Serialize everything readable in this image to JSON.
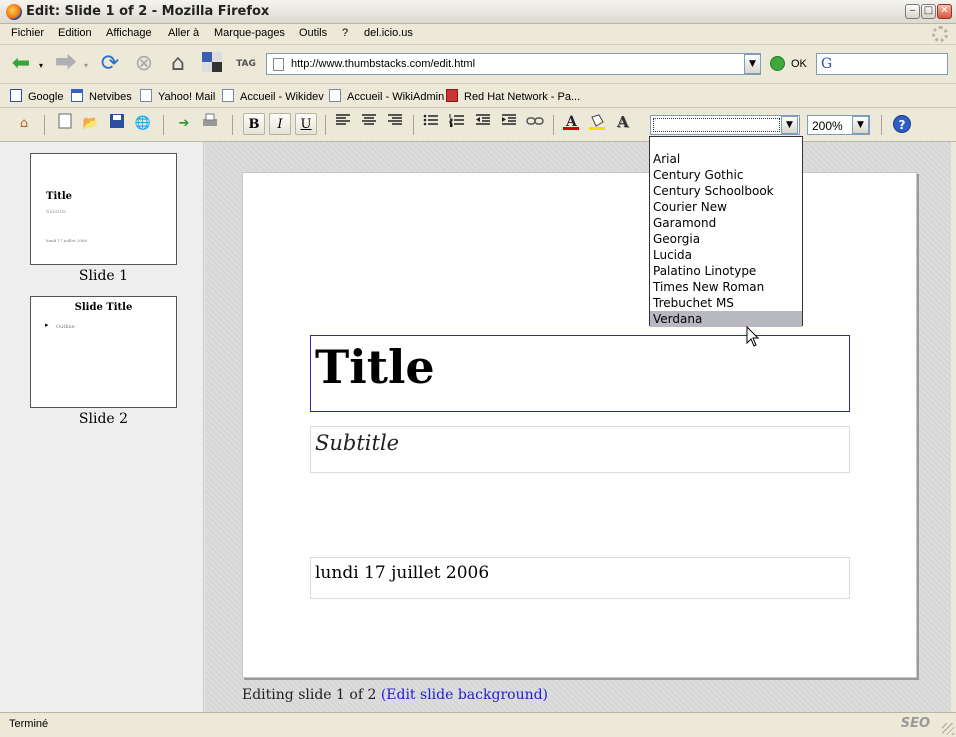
{
  "window": {
    "title": "Edit: Slide 1 of 2 - Mozilla Firefox",
    "minimize": "‒",
    "maximize": "□",
    "close": "✕"
  },
  "menu": [
    "Fichier",
    "Edition",
    "Affichage",
    "Aller à",
    "Marque-pages",
    "Outils",
    "?",
    "del.icio.us"
  ],
  "nav": {
    "url": "http://www.thumbstacks.com/edit.html",
    "go_label": "OK",
    "search_logo": "G"
  },
  "bookmarks": [
    "Google",
    "Netvibes",
    "Yahoo! Mail",
    "Accueil - Wikidev",
    "Accueil - WikiAdmin",
    "Red Hat Network - Pa..."
  ],
  "toolbar": {
    "bold": "B",
    "italic": "I",
    "underline": "U",
    "font_value": "",
    "zoom_value": "200%",
    "help": "?"
  },
  "font_options": [
    "Arial",
    "Century Gothic",
    "Century Schoolbook",
    "Courier New",
    "Garamond",
    "Georgia",
    "Lucida",
    "Palatino Linotype",
    "Times New Roman",
    "Trebuchet MS",
    "Verdana"
  ],
  "font_highlighted": "Verdana",
  "thumbnails": [
    {
      "label": "Slide 1",
      "title": "Title",
      "subtitle": "Subtitle",
      "date": "lundi 17 juillet 2006"
    },
    {
      "label": "Slide 2",
      "title": "Slide Title",
      "bullet": "Outline"
    }
  ],
  "slide": {
    "title": "Title",
    "subtitle": "Subtitle",
    "date": "lundi 17 juillet 2006"
  },
  "editing": {
    "prefix": "Editing slide 1 of 2",
    "link": "(Edit slide background)"
  },
  "status": {
    "text": "Terminé",
    "seo": "SEO"
  }
}
